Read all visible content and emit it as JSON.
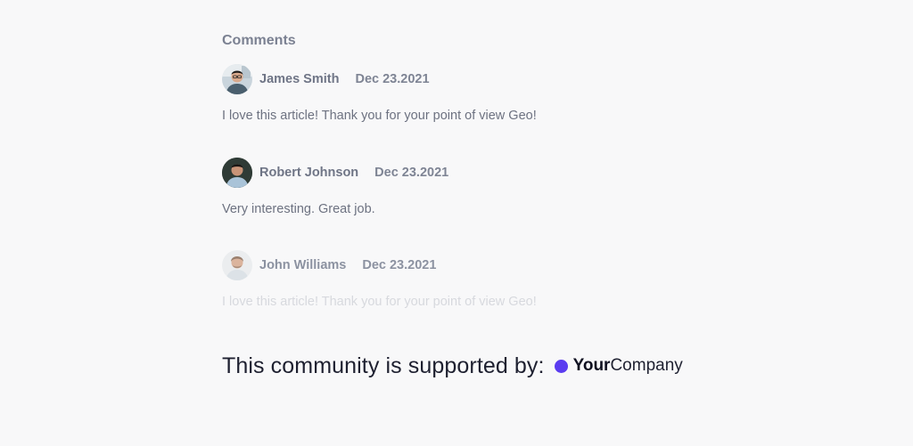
{
  "comments_section": {
    "title": "Comments",
    "items": [
      {
        "author": "James Smith",
        "date": "Dec 23.2021",
        "text": "I love this article! Thank you for your point of view Geo!",
        "avatar": "person-photo-avatar"
      },
      {
        "author": "Robert Johnson",
        "date": "Dec 23.2021",
        "text": "Very interesting. Great job.",
        "avatar": "person-photo-avatar"
      },
      {
        "author": "John Williams",
        "date": "Dec 23.2021",
        "text": "I love this article! Thank you for your point of view Geo!",
        "avatar": "person-photo-avatar"
      }
    ]
  },
  "sponsor": {
    "label": "This community is supported by:",
    "brand_bold": "Your",
    "brand_regular": "Company",
    "brand_color": "#5b3cf0"
  }
}
